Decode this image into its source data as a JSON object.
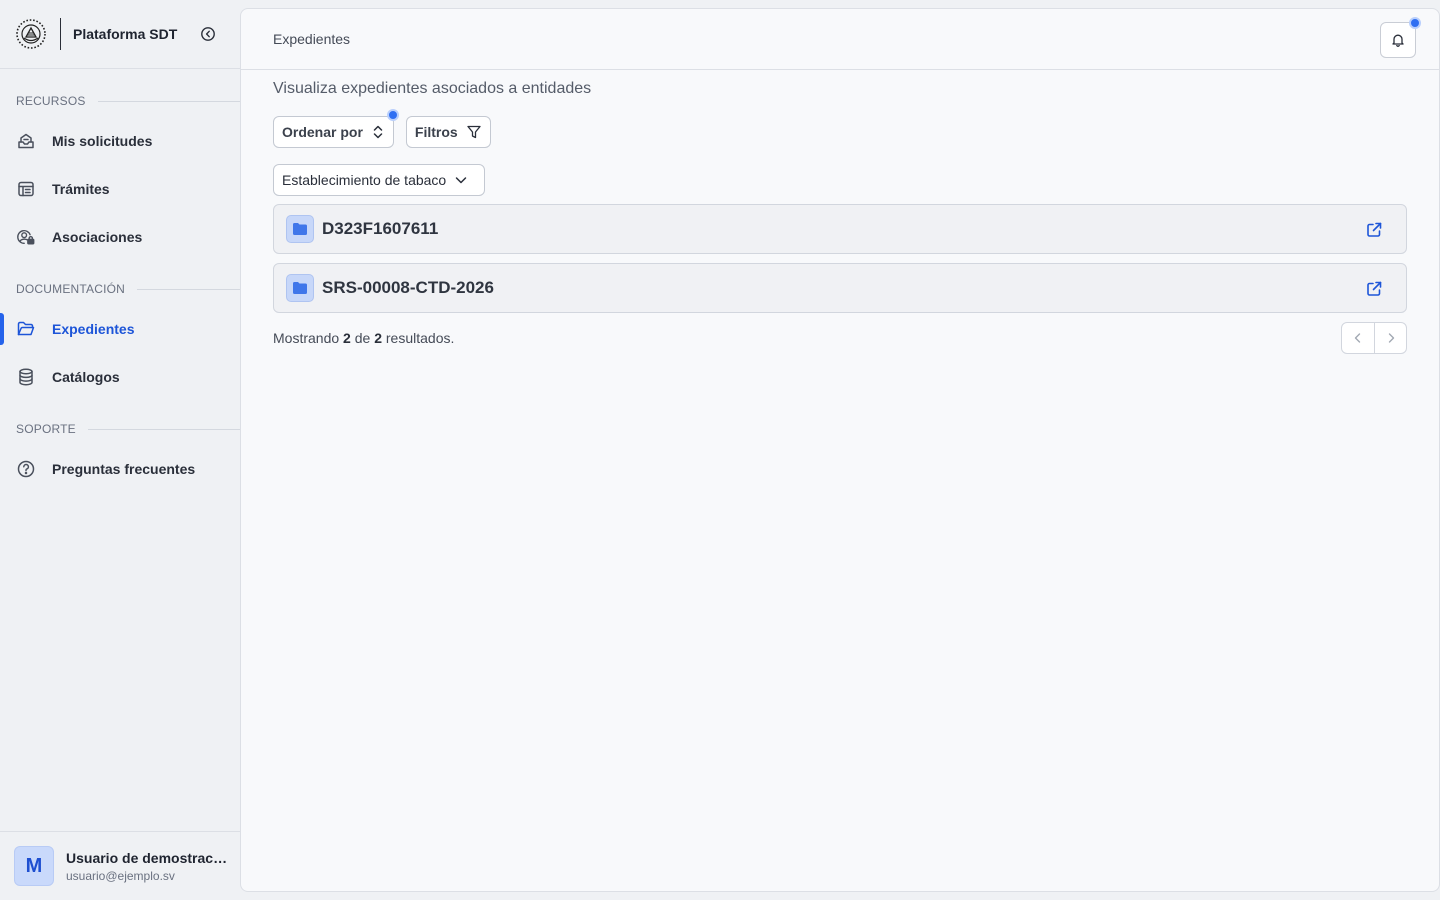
{
  "sidebar": {
    "app_title": "Plataforma SDT",
    "sections": [
      {
        "label": "RECURSOS",
        "items": [
          {
            "label": "Mis solicitudes",
            "icon": "inbox-icon"
          },
          {
            "label": "Trámites",
            "icon": "calendar-table-icon"
          },
          {
            "label": "Asociaciones",
            "icon": "user-circle-lock-icon"
          }
        ]
      },
      {
        "label": "DOCUMENTACIÓN",
        "items": [
          {
            "label": "Expedientes",
            "icon": "folder-open-icon",
            "active": true
          },
          {
            "label": "Catálogos",
            "icon": "database-icon"
          }
        ]
      },
      {
        "label": "SOPORTE",
        "items": [
          {
            "label": "Preguntas frecuentes",
            "icon": "help-circle-icon"
          }
        ]
      }
    ],
    "user": {
      "initial": "M",
      "name": "Usuario de demostración",
      "email": "usuario@ejemplo.sv"
    }
  },
  "header": {
    "breadcrumb": "Expedientes"
  },
  "main": {
    "subtitle": "Visualiza expedientes asociados a entidades",
    "sort_label": "Ordenar por",
    "filters_label": "Filtros",
    "entity_select_value": "Establecimiento de tabaco",
    "records": [
      {
        "code": "D323F1607611"
      },
      {
        "code": "SRS-00008-CTD-2026"
      }
    ],
    "results": {
      "prefix": "Mostrando",
      "shown": "2",
      "middle": "de",
      "total": "2",
      "suffix": "resultados."
    }
  },
  "colors": {
    "accent": "#2563eb",
    "notification_dot": "#2f6ff2",
    "folder_bg": "#c7d7f9"
  }
}
